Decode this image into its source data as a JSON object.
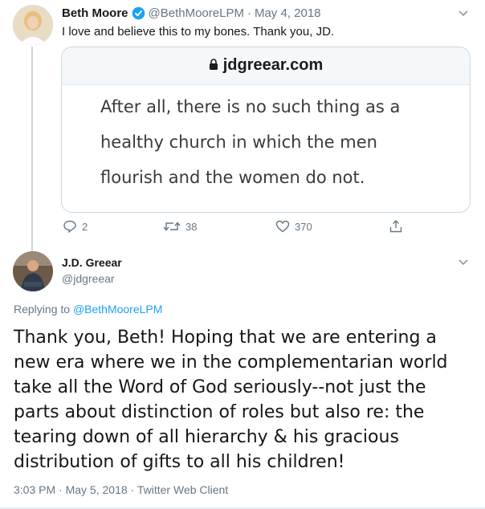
{
  "tweet1": {
    "author_name": "Beth Moore",
    "handle": "@BethMooreLPM",
    "separator": "·",
    "date": "May 4, 2018",
    "text": "I love and believe this to my bones. Thank you, JD.",
    "card": {
      "domain": "jdgreear.com",
      "quote": "After all, there is no such thing as a healthy church in which the men flourish and the women do not."
    },
    "replies": "2",
    "retweets": "38",
    "likes": "370"
  },
  "tweet2": {
    "author_name": "J.D. Greear",
    "handle": "@jdgreear",
    "replying_prefix": "Replying to",
    "replying_handle": "@BethMooreLPM",
    "text": "Thank you, Beth! Hoping that we are entering a new era where we in the complementarian world take all the Word of God seriously--not just the parts about distinction of roles but also re: the tearing down of all hierarchy & his gracious distribution of gifts to all his children!",
    "time": "3:03 PM",
    "separator": "·",
    "date": "May 5, 2018",
    "client": "Twitter Web Client"
  },
  "colors": {
    "accent": "#1da1f2",
    "muted": "#657786",
    "border": "#ccd6dd"
  }
}
